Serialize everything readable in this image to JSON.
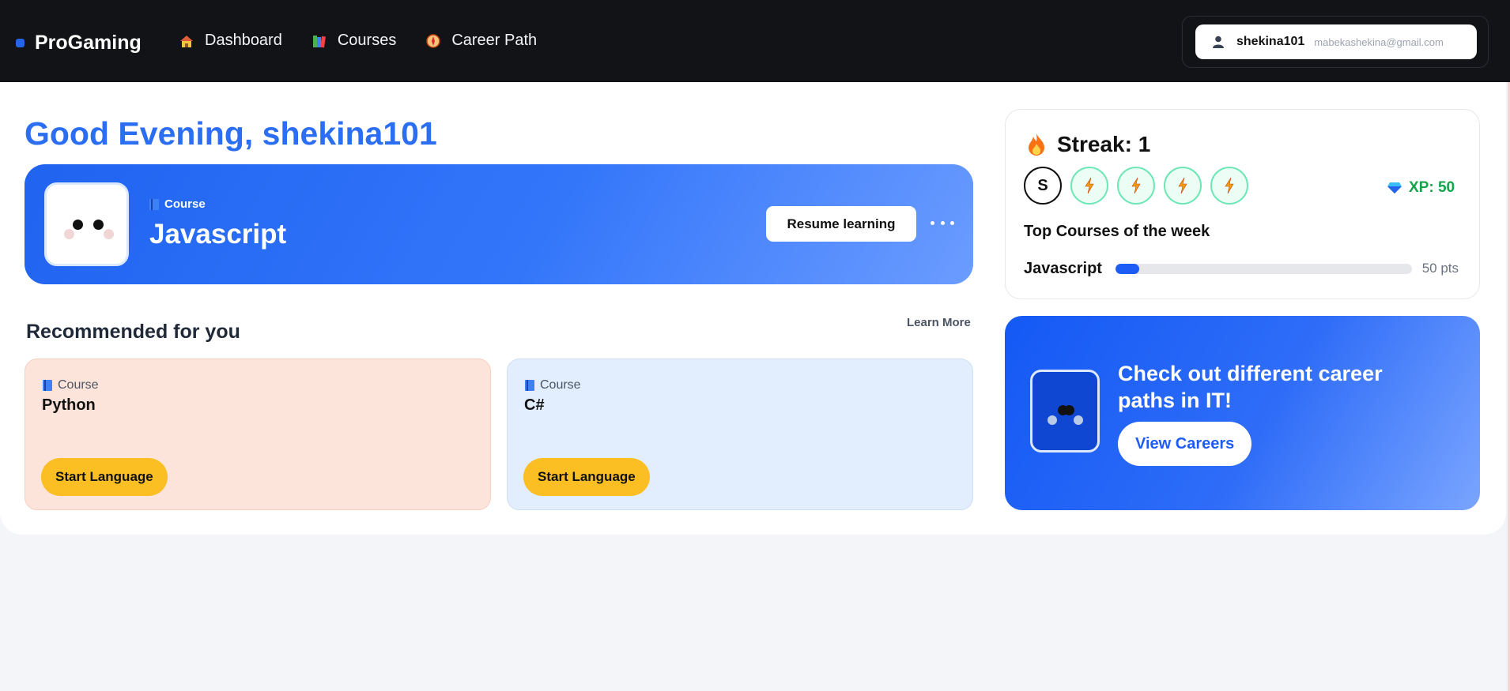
{
  "nav": {
    "brand": "ProGaming",
    "links": [
      {
        "label": "Dashboard",
        "icon": "house-icon"
      },
      {
        "label": "Courses",
        "icon": "books-icon"
      },
      {
        "label": "Career Path",
        "icon": "compass-icon"
      }
    ],
    "user": {
      "name": "shekina101",
      "email": "mabekashekina@gmail.com",
      "icon": "user-icon"
    }
  },
  "greeting": "Good Evening, shekina101",
  "hero": {
    "tag": "Course",
    "title": "Javascript",
    "resume_label": "Resume learning",
    "more_icon": "ellipsis-icon"
  },
  "recommended": {
    "title": "Recommended for you",
    "learn_more": "Learn More",
    "items": [
      {
        "tag": "Course",
        "name": "Python",
        "button": "Start Language",
        "color": "#fde4db"
      },
      {
        "tag": "Course",
        "name": "C#",
        "button": "Start Language",
        "color": "#e2edfd"
      }
    ]
  },
  "streak": {
    "label": "Streak: 1",
    "first_day": "S",
    "xp": "XP: 50",
    "top_title": "Top Courses of the week",
    "top_courses": [
      {
        "name": "Javascript",
        "points": "50 pts",
        "progress": 0.08
      }
    ]
  },
  "career": {
    "text": "Check out different career paths in IT!",
    "button": "View Careers"
  },
  "colors": {
    "accent": "#2b6ef2",
    "nav_bg": "#111317",
    "button_yellow": "#fbbf24",
    "xp_green": "#16a34a"
  }
}
